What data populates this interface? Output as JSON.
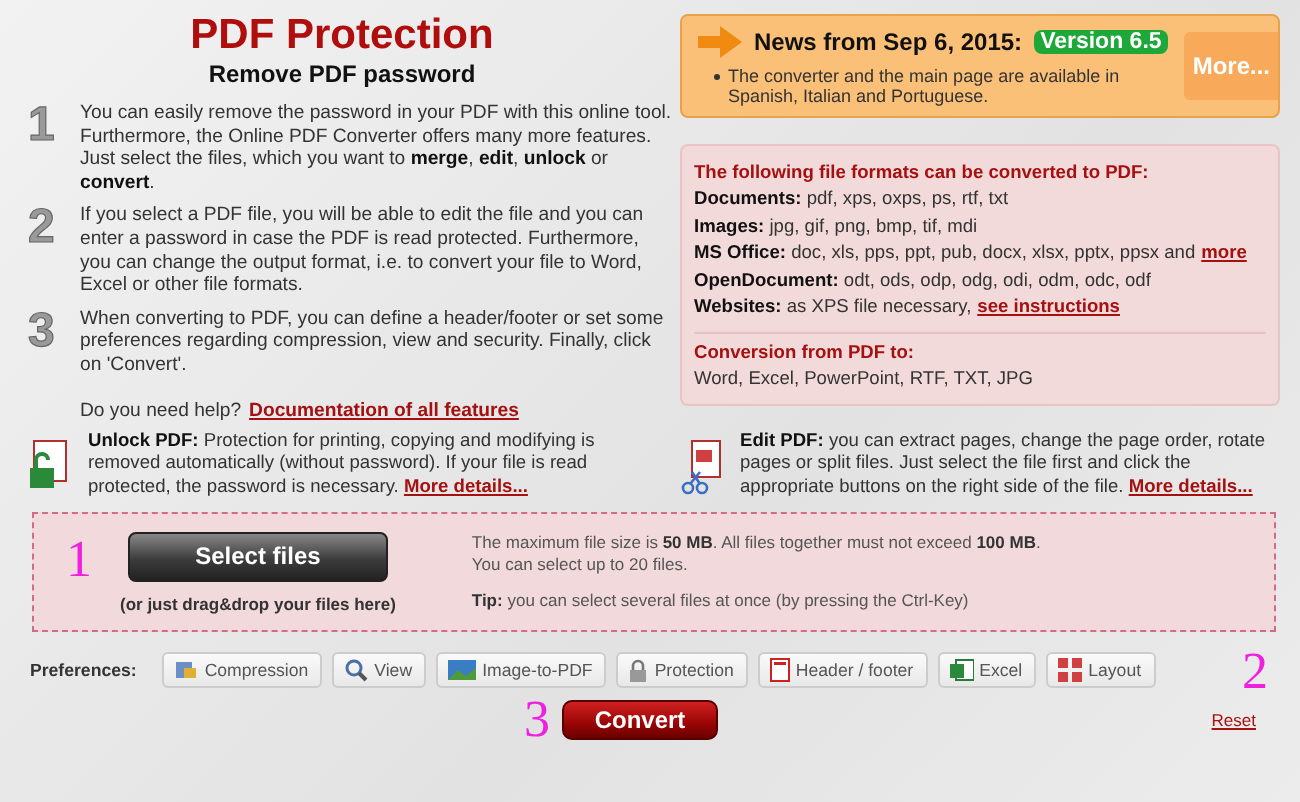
{
  "header": {
    "title": "PDF Protection",
    "subtitle": "Remove PDF password"
  },
  "steps": [
    {
      "number": "1",
      "text": "You can easily remove the password in your PDF with this online tool. Furthermore, the Online PDF Converter offers many more features. Just select the files, which you want to **merge**, **edit**, **unlock** or **convert**."
    },
    {
      "number": "2",
      "text": "If you select a PDF file, you will be able to edit the file and you can enter a password in case the PDF is read protected. Furthermore, you can change the output format, i.e. to convert your file to Word, Excel or other file formats."
    },
    {
      "number": "3",
      "text": "When converting to PDF, you can define a header/footer or set some preferences regarding compression, view and security. Finally, click on 'Convert'."
    }
  ],
  "help": {
    "text": "Do you need help?",
    "link": "Documentation of all features"
  },
  "news": {
    "title": "News from Sep 6, 2015:",
    "badge": "Version 6.5",
    "items": [
      "The converter and the main page are available in Spanish, Italian and Portuguese."
    ],
    "more": "More..."
  },
  "formats": {
    "heading": "The following file formats can be converted to PDF:",
    "rows": [
      {
        "label": "Documents:",
        "text": "pdf, xps, oxps, ps, rtf, txt"
      },
      {
        "label": "Images:",
        "text": "jpg, gif, png, bmp, tif, mdi"
      },
      {
        "label": "MS Office:",
        "text": "doc, xls, pps, ppt, pub, docx, xlsx, pptx, ppsx and",
        "link": "more"
      },
      {
        "label": "OpenDocument:",
        "text": "odt, ods, odp, odg, odi, odm, odc, odf"
      },
      {
        "label": "Websites:",
        "text": "as XPS file necessary,",
        "link": "see instructions"
      }
    ],
    "conversion_heading": "Conversion from PDF to:",
    "conversion_text": "Word, Excel, PowerPoint, RTF, TXT, JPG"
  },
  "features": [
    {
      "kind": "unlock",
      "title": "Unlock PDF:",
      "text": "Protection for printing, copying and modifying is removed automatically (without password). If your file is read protected, the password is necessary.",
      "link": "More details..."
    },
    {
      "kind": "edit",
      "title": "Edit PDF:",
      "text": "you can extract pages, change the page order, rotate pages or split files. Just select the file first and click the appropriate buttons on the right side of the file.",
      "link": "More details..."
    }
  ],
  "upload": {
    "button": "Select files",
    "hint": "(or just drag&drop your files here)",
    "info": [
      "The maximum file size is **50 MB**. All files together must not exceed **100 MB**.",
      "You can select up to 20 files."
    ],
    "tip_label": "Tip:",
    "tip": "you can select several files at once (by pressing the Ctrl-Key)"
  },
  "preferences": {
    "label": "Preferences:",
    "buttons": [
      {
        "kind": "compression",
        "label": "Compression"
      },
      {
        "kind": "view",
        "label": "View"
      },
      {
        "kind": "image",
        "label": "Image-to-PDF"
      },
      {
        "kind": "protection",
        "label": "Protection"
      },
      {
        "kind": "header",
        "label": "Header / footer"
      },
      {
        "kind": "excel",
        "label": "Excel"
      },
      {
        "kind": "layout",
        "label": "Layout"
      }
    ]
  },
  "convert": "Convert",
  "reset": "Reset",
  "annotations": [
    "1",
    "2",
    "3"
  ]
}
